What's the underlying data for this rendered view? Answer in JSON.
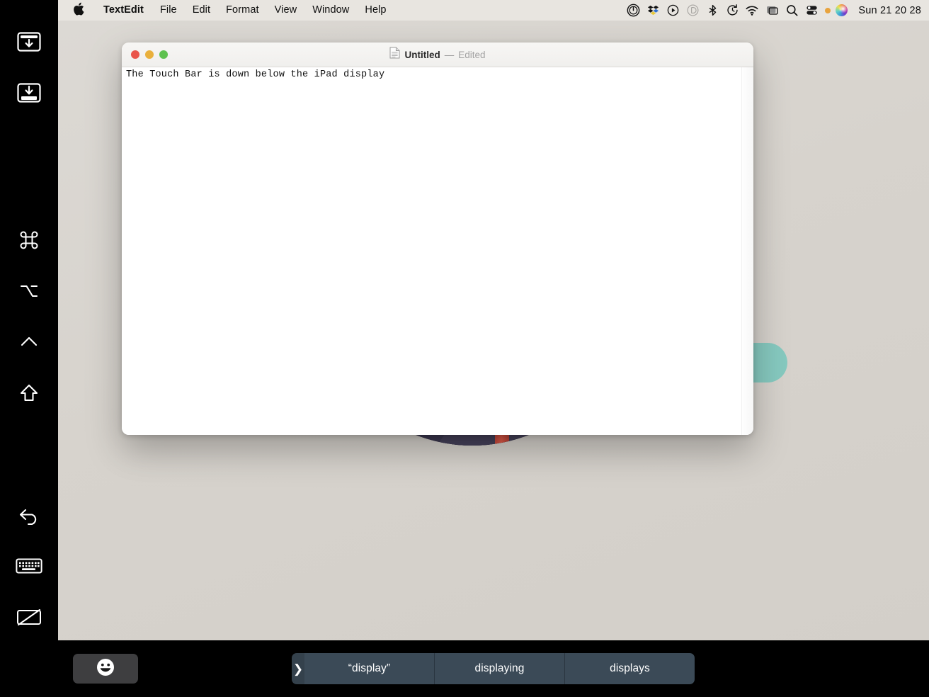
{
  "menubar": {
    "apple_icon": "apple-logo-icon",
    "app_name": "TextEdit",
    "items": [
      "File",
      "Edit",
      "Format",
      "View",
      "Window",
      "Help"
    ],
    "status_icons": [
      "do-not-disturb-icon",
      "dropbox-icon",
      "play-circle-icon",
      "duet-display-icon",
      "bluetooth-icon",
      "time-machine-icon",
      "wifi-icon",
      "screen-sharing-icon",
      "spotlight-search-icon",
      "control-center-icon",
      "siri-orb-icon"
    ],
    "clock": "Sun 21 20 28"
  },
  "sidebar": {
    "items": [
      {
        "name": "window-capture-down-icon",
        "label": "Capture window"
      },
      {
        "name": "screen-capture-down-icon",
        "label": "Capture screen"
      },
      {
        "name": "command-key-icon",
        "label": "Command"
      },
      {
        "name": "option-key-icon",
        "label": "Option"
      },
      {
        "name": "control-key-icon",
        "label": "Control"
      },
      {
        "name": "shift-key-icon",
        "label": "Shift"
      },
      {
        "name": "undo-icon",
        "label": "Undo"
      },
      {
        "name": "keyboard-icon",
        "label": "Keyboard"
      },
      {
        "name": "screen-off-icon",
        "label": "Screen off"
      }
    ]
  },
  "window": {
    "title": "Untitled",
    "separator": "—",
    "edited_state": "Edited",
    "doc_icon": "document-icon",
    "traffic_lights": {
      "close": "close-button",
      "minimize": "minimize-button",
      "zoom": "zoom-button"
    },
    "document_text": "The Touch Bar is down below the iPad display"
  },
  "touchbar": {
    "emoji_button": "😀",
    "chevron": "❯",
    "suggestions": [
      "“display”",
      "displaying",
      "displays"
    ]
  },
  "colors": {
    "desktop": "#d7d3cd",
    "menubar": "#e8e5e0",
    "touchbar_bg": "#000000",
    "chip_bg": "#3b4a57",
    "emoji_btn_bg": "#3e3e40",
    "teal_shape": "#86c9bf",
    "torii_red": "#d44f40",
    "traffic_red": "#e9554b",
    "traffic_yellow": "#e9b03c",
    "traffic_green": "#5ec14f"
  }
}
